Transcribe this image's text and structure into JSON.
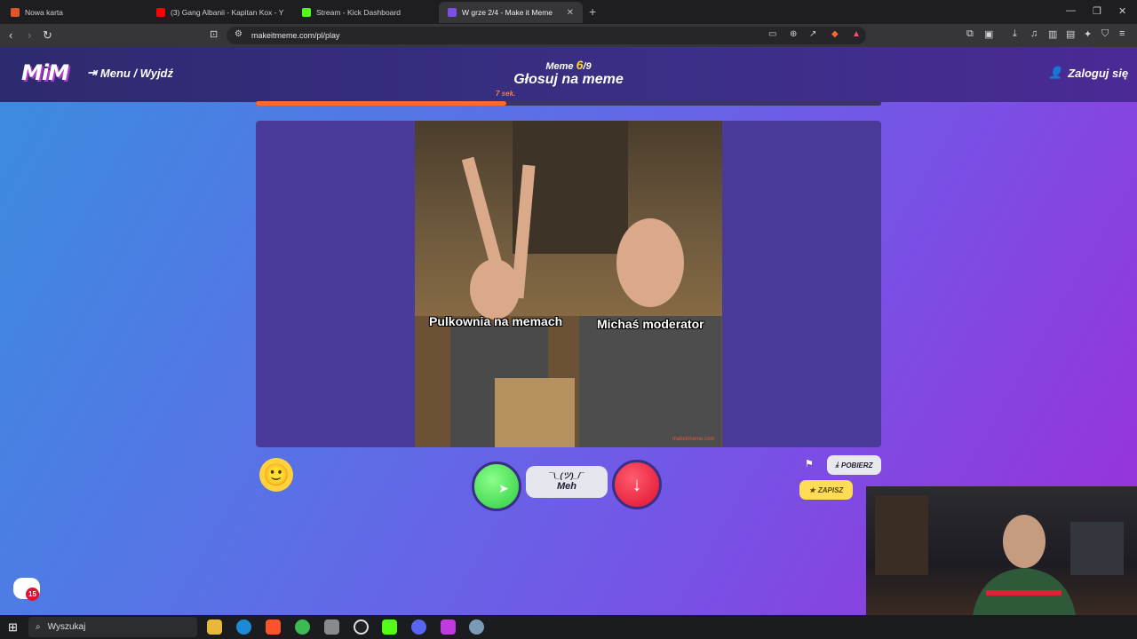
{
  "browser": {
    "tabs": [
      {
        "title": "Nowa karta",
        "color": "#e2542a"
      },
      {
        "title": "(3) Gang Albanii - Kapitan Kox - Y",
        "color": "#ff0000"
      },
      {
        "title": "Stream - Kick Dashboard",
        "color": "#53fc18"
      },
      {
        "title": "W grze 2/4 - Make it Meme",
        "color": "#7a4fe6"
      }
    ],
    "url": "makeitmeme.com/pl/play"
  },
  "header": {
    "logo": "MiM",
    "menu_label": "Menu / Wyjdź",
    "round_prefix": "Meme",
    "round_current": "6",
    "round_total": "/9",
    "title": "Głosuj na meme",
    "login_label": "Zaloguj się"
  },
  "timer": {
    "label": "7 sek.",
    "progress_fraction": 0.4
  },
  "meme": {
    "captions": [
      "Pulkownia na memach",
      "Michaś moderator"
    ],
    "watermark": "makeitmeme.com"
  },
  "vote": {
    "meh_shrug": "¯\\_(ツ)_/¯",
    "meh_label": "Meh",
    "down_icon": "arrow-down-icon"
  },
  "actions": {
    "download_label": "POBIERZ",
    "save_label": "ZAPISZ"
  },
  "chat": {
    "unread_count": "15"
  },
  "taskbar": {
    "search_placeholder": "Wyszukaj"
  }
}
